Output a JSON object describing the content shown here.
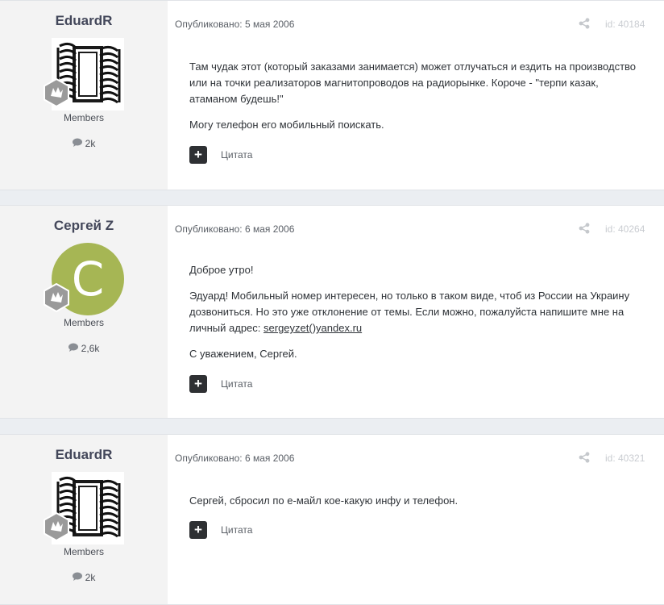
{
  "posts": [
    {
      "author": "EduardR",
      "avatar": "coil-avatar",
      "group": "Members",
      "post_count": "2k",
      "published": "Опубликовано: 5 мая 2006",
      "id_label": "id: 40184",
      "paragraphs": [
        "Там чудак этот (который заказами занимается) может отлучаться и ездить на производство или на точки реализаторов магнитопроводов на радиорынке. Короче - \"терпи казак, атаманом будешь!\"",
        "Могу телефон его мобильный поискать."
      ],
      "quote_label": "Цитата"
    },
    {
      "author": "Сергей Z",
      "avatar_letter": "C",
      "group": "Members",
      "post_count": "2,6k",
      "published": "Опубликовано: 6 мая 2006",
      "id_label": "id: 40264",
      "paragraphs": [
        "Доброе утро!",
        "Эдуард! Мобильный номер интересен, но только в таком виде, чтоб из России на Украину дозвониться. Но это уже отклонение от темы. Если можно, пожалуйста напишите мне на личный адрес: ",
        "С уважением, Сергей."
      ],
      "email_link": "sergeyzet()yandex.ru",
      "quote_label": "Цитата"
    },
    {
      "author": "EduardR",
      "avatar": "coil-avatar",
      "group": "Members",
      "post_count": "2k",
      "published": "Опубликовано: 6 мая 2006",
      "id_label": "id: 40321",
      "paragraphs": [
        "Сергей, сбросил по e-майл кое-какую инфу и телефон."
      ],
      "quote_label": "Цитата"
    }
  ],
  "icons": {
    "share": "share-icon",
    "comment": "comment-icon",
    "plus": "plus-icon",
    "rank": "rank-badge-icon"
  },
  "colors": {
    "author_bg": "#f3f3f3",
    "page_bg": "#ebeef2",
    "letter_avatar": "#a6b654",
    "plus_button": "#2e3033"
  }
}
